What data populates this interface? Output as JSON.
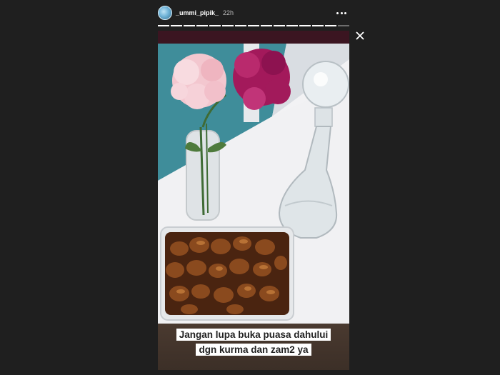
{
  "story": {
    "username": "_ummi_pipik_",
    "time_ago": "22h",
    "segments_total": 15,
    "segments_done": 14,
    "caption_line1": "Jangan lupa buka puasa dahului",
    "caption_line2": "dgn kurma dan zam2 ya"
  },
  "icons": {
    "avatar": "avatar",
    "more": "more-options-icon",
    "close": "close-icon"
  },
  "colors": {
    "background": "#1f1f1f",
    "caption_bg": "#3c2f27",
    "text": "#ffffff"
  }
}
